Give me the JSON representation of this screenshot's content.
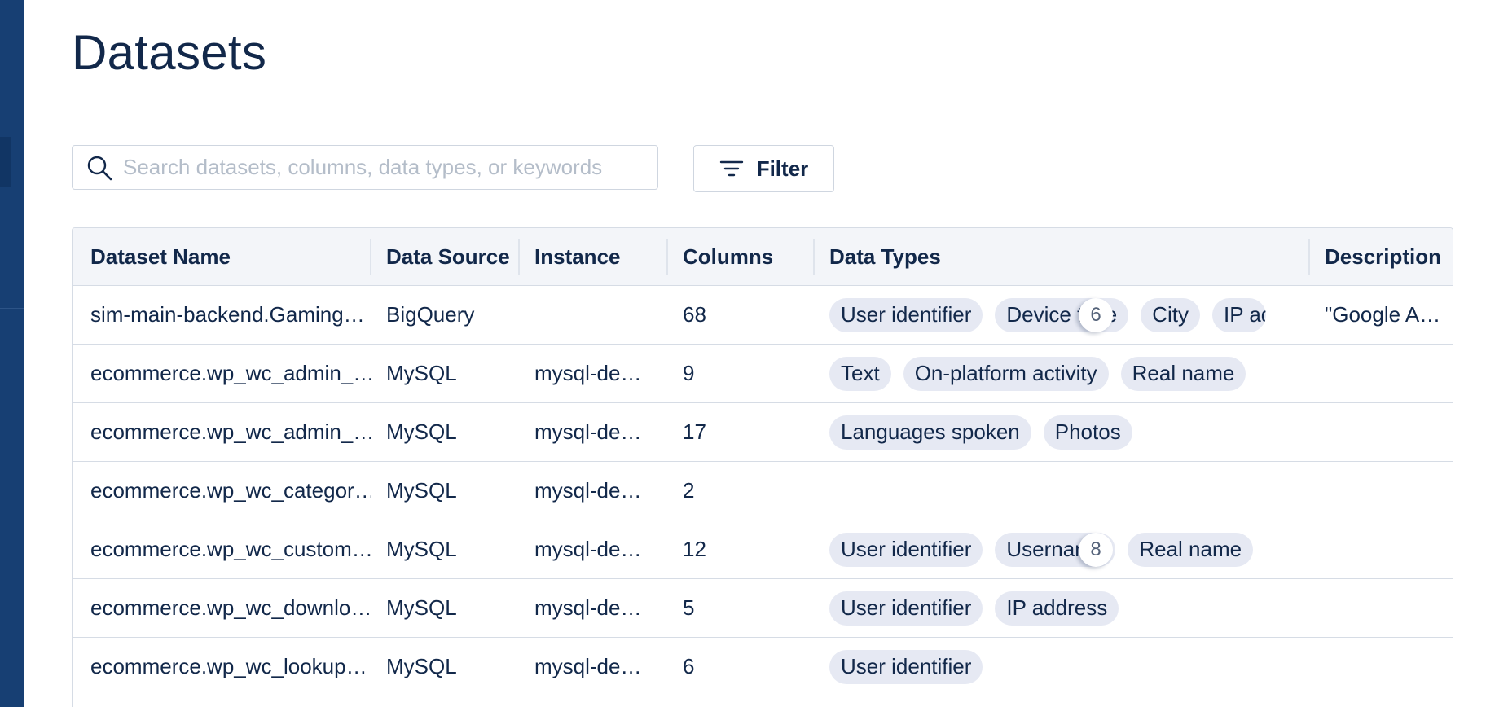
{
  "page": {
    "title": "Datasets"
  },
  "search": {
    "placeholder": "Search datasets, columns, data types, or keywords"
  },
  "filter": {
    "label": "Filter"
  },
  "table": {
    "headers": {
      "name": "Dataset Name",
      "source": "Data Source",
      "instance": "Instance",
      "columns": "Columns",
      "types": "Data Types",
      "description": "Description"
    },
    "rows": [
      {
        "name": "sim-main-backend.Gaming…",
        "source": "BigQuery",
        "instance": "",
        "columns": "68",
        "types": [
          "User identifier",
          "Device type",
          "City",
          "IP ad"
        ],
        "more": "6",
        "description": "\"Google A…"
      },
      {
        "name": "ecommerce.wp_wc_admin_…",
        "source": "MySQL",
        "instance": "mysql-de…",
        "columns": "9",
        "types": [
          "Text",
          "On-platform activity",
          "Real name"
        ],
        "more": "",
        "description": ""
      },
      {
        "name": "ecommerce.wp_wc_admin_…",
        "source": "MySQL",
        "instance": "mysql-de…",
        "columns": "17",
        "types": [
          "Languages spoken",
          "Photos"
        ],
        "more": "",
        "description": ""
      },
      {
        "name": "ecommerce.wp_wc_categor…",
        "source": "MySQL",
        "instance": "mysql-de…",
        "columns": "2",
        "types": [],
        "more": "",
        "description": ""
      },
      {
        "name": "ecommerce.wp_wc_custom…",
        "source": "MySQL",
        "instance": "mysql-de…",
        "columns": "12",
        "types": [
          "User identifier",
          "Username",
          "Real name"
        ],
        "more": "8",
        "description": ""
      },
      {
        "name": "ecommerce.wp_wc_downlo…",
        "source": "MySQL",
        "instance": "mysql-de…",
        "columns": "5",
        "types": [
          "User identifier",
          "IP address"
        ],
        "more": "",
        "description": ""
      },
      {
        "name": "ecommerce.wp_wc_lookup…",
        "source": "MySQL",
        "instance": "mysql-de…",
        "columns": "6",
        "types": [
          "User identifier"
        ],
        "more": "",
        "description": ""
      }
    ]
  },
  "colors": {
    "sidebar": "#173f73",
    "text": "#12284a",
    "chip": "#e6e9f3",
    "header_bg": "#f3f5f9"
  }
}
